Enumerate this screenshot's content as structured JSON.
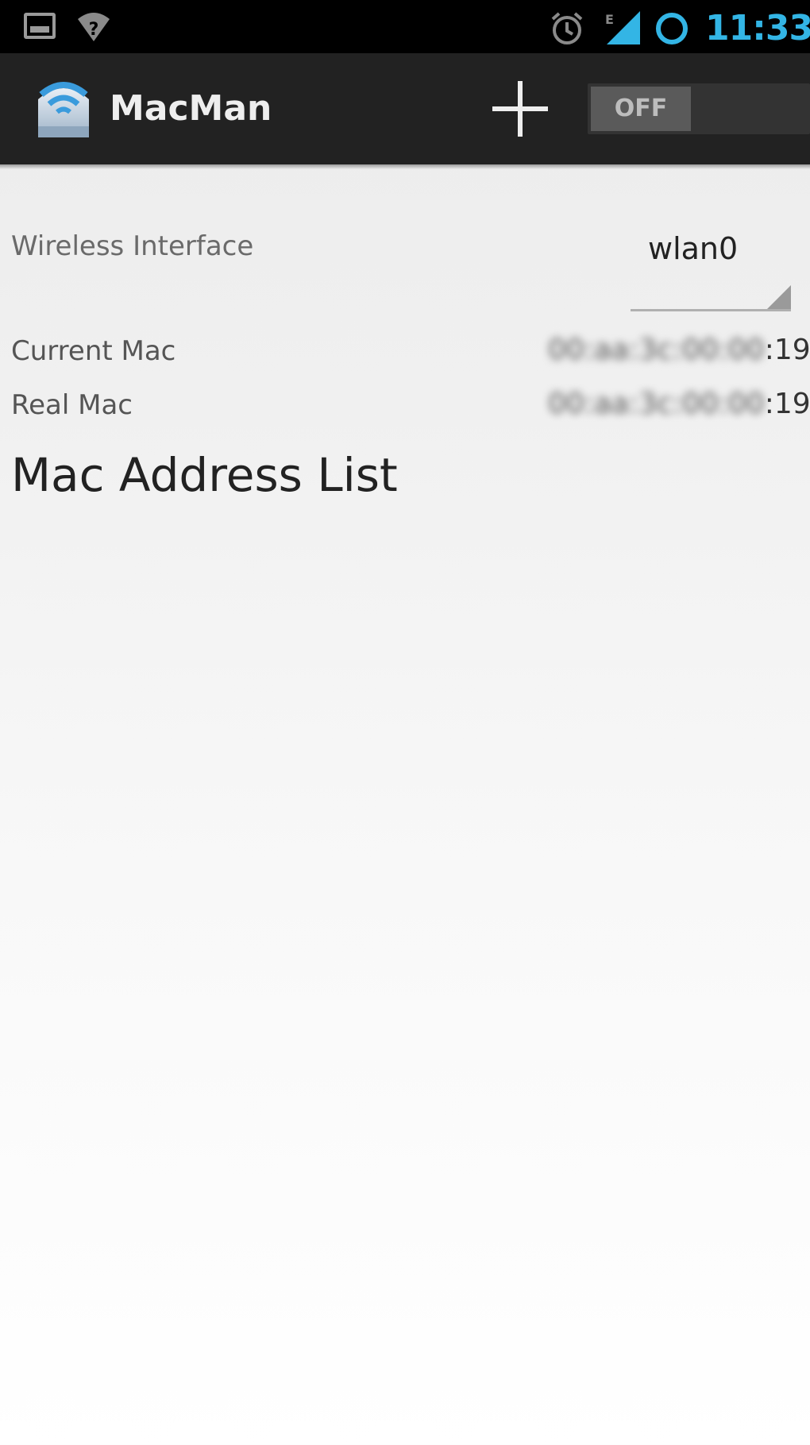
{
  "status_bar": {
    "time": "11:33",
    "icons": [
      "gallery-icon",
      "wifi-unknown-icon",
      "alarm-icon",
      "signal-icon",
      "sync-icon"
    ],
    "accent_color": "#33b5e5"
  },
  "action_bar": {
    "title": "MacMan",
    "app_icon": "macman-wifi-icon",
    "add_icon": "plus-icon",
    "toggle_label": "OFF",
    "toggle_state": "off"
  },
  "settings": {
    "wireless_label": "Wireless Interface",
    "interface_value": "wlan0",
    "current_mac_label": "Current Mac",
    "current_mac_visible_suffix": ":19",
    "real_mac_label": "Real Mac",
    "real_mac_visible_suffix": ":19"
  },
  "mac_list": {
    "title": "Mac Address List",
    "items": []
  }
}
